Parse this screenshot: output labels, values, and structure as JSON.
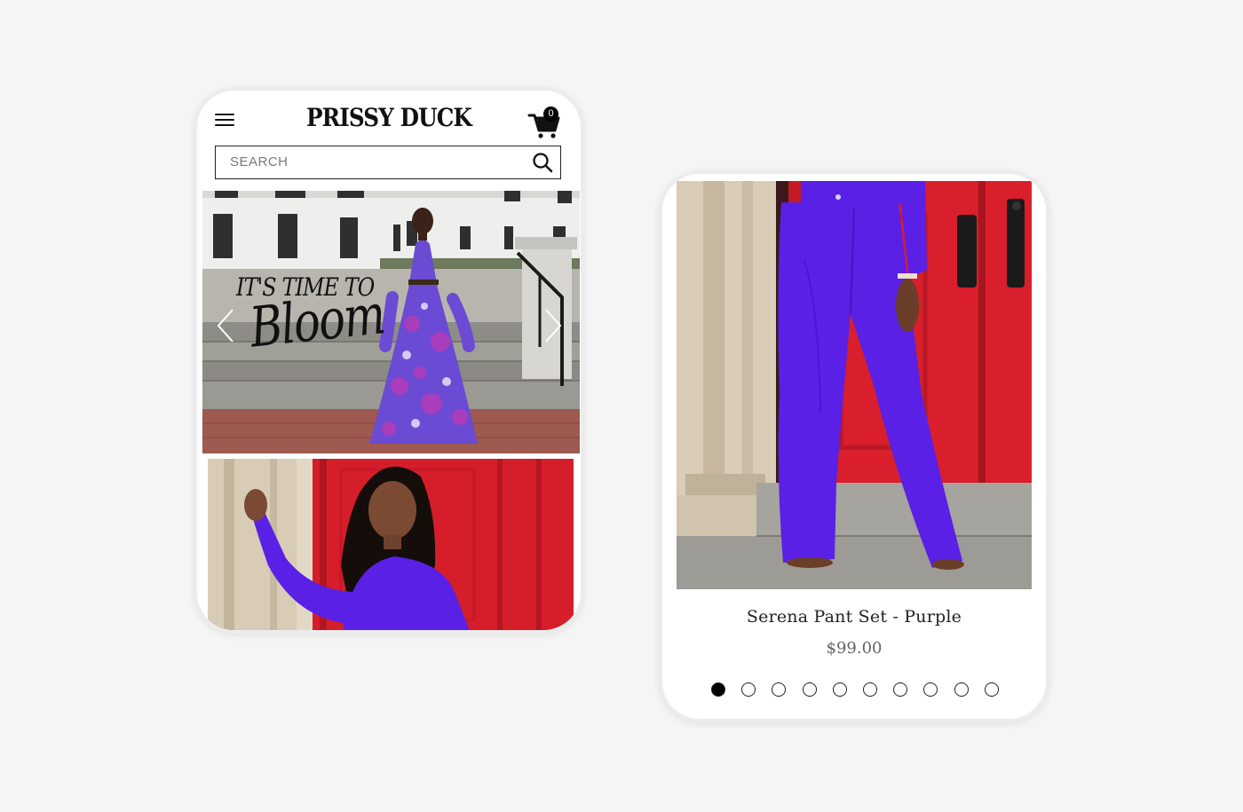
{
  "store": {
    "brand": "PRISSY DUCK",
    "cart_count": "0"
  },
  "search": {
    "placeholder": "SEARCH"
  },
  "hero": {
    "line1": "IT'S TIME TO",
    "line2": "Bloom"
  },
  "product": {
    "title": "Serena Pant Set - Purple",
    "price": "$99.00"
  },
  "carousel": {
    "total": 10,
    "active_index": 0
  },
  "colors": {
    "purple": "#5a20e6",
    "red_door": "#d9202c",
    "background": "#f5f5f5"
  },
  "icons": [
    "menu-icon",
    "cart-icon",
    "search-icon",
    "chevron-left-icon",
    "chevron-right-icon"
  ]
}
